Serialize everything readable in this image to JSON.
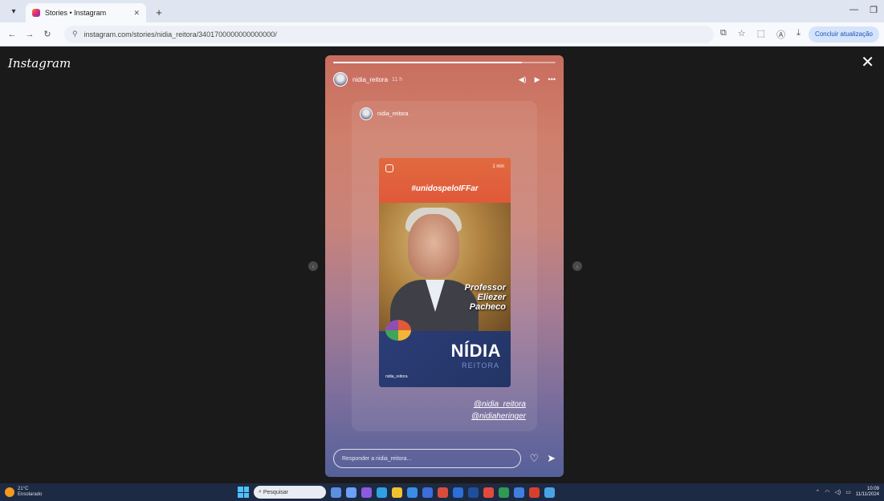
{
  "browser": {
    "tab_title": "Stories • Instagram",
    "url": "instagram.com/stories/nidia_reitora/3401700000000000000/",
    "profile_button": "Concluir atualização",
    "icons": [
      "menu-icon",
      "close-tab-icon",
      "new-tab-icon",
      "back-icon",
      "forward-icon",
      "reload-icon",
      "site-info-icon",
      "install-icon",
      "bookmark-icon",
      "extensions-icon",
      "translate-icon",
      "download-icon"
    ]
  },
  "instagram": {
    "logo": "Instagram",
    "close_symbol": "✕"
  },
  "story": {
    "username": "nidia_reitora",
    "time": "11 h",
    "progress": 0.85,
    "inner_username": "nidia_reitora",
    "post": {
      "time": "1 min",
      "hashtag": "#unidospeloIFFar",
      "person_name_line1": "Professor",
      "person_name_line2": "Eliezer",
      "person_name_line3": "Pacheco",
      "brand": "NÍDIA",
      "brand_sub": "REITORA",
      "post_user": "nidia_reitora"
    },
    "mention_1": "@nidia_reitora",
    "mention_2": "@nidiaheringer",
    "reply_placeholder": "Responder a nidia_reitora..."
  },
  "taskbar": {
    "weather_temp": "21°C",
    "weather_desc": "Ensolarado",
    "search_placeholder": "Pesquisar",
    "time": "10:09",
    "date": "11/11/2024"
  },
  "colors": {
    "accent_orange": "#e16a3f",
    "post_navy": "#2b3d76"
  }
}
